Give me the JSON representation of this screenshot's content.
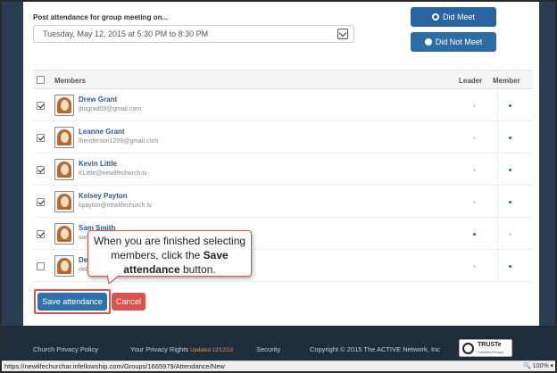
{
  "form": {
    "post_label": "Post attendance for group meeting on...",
    "meeting_date": "Tuesday, May 12, 2015 at 5:30 PM to 8:30 PM",
    "did_meet_label": "Did Meet",
    "did_not_meet_label": "Did Not Meet",
    "did_meet_selected": true
  },
  "table": {
    "col_members": "Members",
    "col_leader": "Leader",
    "col_member": "Member"
  },
  "members": [
    {
      "name": "Drew Grant",
      "email": "jbugrad09@gmail.com",
      "checked": true,
      "role": "member"
    },
    {
      "name": "Leanne Grant",
      "email": "lhenderson1209@gmail.com",
      "checked": true,
      "role": "member"
    },
    {
      "name": "Kevin Little",
      "email": "KLittle@newlifechurch.tv",
      "checked": true,
      "role": "member"
    },
    {
      "name": "Kelsey Payton",
      "email": "kpayton@newlifechurch.tv",
      "checked": true,
      "role": "member"
    },
    {
      "name": "Sam Smith",
      "email": "sam",
      "checked": true,
      "role": "leader"
    },
    {
      "name": "Deb",
      "email": "deb",
      "checked": false,
      "role": "member"
    }
  ],
  "tooltip": {
    "line1": "When you are finished selecting",
    "line2": "members, click the",
    "bold1": "Save",
    "bold2": "attendance",
    "line3": "button."
  },
  "actions": {
    "save_label": "Save attendance",
    "cancel_label": "Cancel"
  },
  "footer": {
    "privacy_policy": "Church Privacy Policy",
    "privacy_rights": "Your Privacy Rights",
    "updated": "Updated 12/12/13",
    "security": "Security",
    "copyright": "Copyright © 2015 The ACTIVE Network, Inc",
    "truste": "TRUSTe",
    "truste_sub": "Certified Privacy"
  },
  "statusbar": {
    "url": "https://newlifechurchar.infellowship.com/Groups/1665979/Attendance/New",
    "zoom": "100%"
  },
  "colors": {
    "primary": "#3071a9",
    "danger": "#d9534f",
    "footer_bg": "#1f2c3b"
  }
}
